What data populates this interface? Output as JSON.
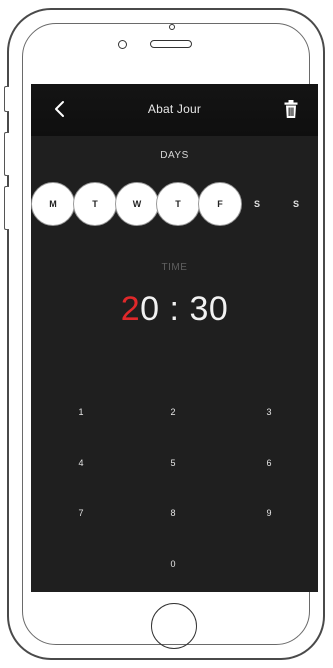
{
  "header": {
    "title": "Abat Jour",
    "back_icon": "chevron-left-icon",
    "delete_icon": "trash-icon"
  },
  "days": {
    "label": "DAYS",
    "items": [
      {
        "letter": "M",
        "selected": true
      },
      {
        "letter": "T",
        "selected": true
      },
      {
        "letter": "W",
        "selected": true
      },
      {
        "letter": "T",
        "selected": true
      },
      {
        "letter": "F",
        "selected": true
      },
      {
        "letter": "S",
        "selected": false
      },
      {
        "letter": "S",
        "selected": false
      }
    ]
  },
  "time": {
    "label": "TIME",
    "hour_first": "2",
    "hour_second": "0",
    "separator": ":",
    "minutes": "30",
    "highlight_color": "#e0282a"
  },
  "keypad": {
    "keys": [
      "1",
      "2",
      "3",
      "4",
      "5",
      "6",
      "7",
      "8",
      "9",
      "0"
    ]
  }
}
